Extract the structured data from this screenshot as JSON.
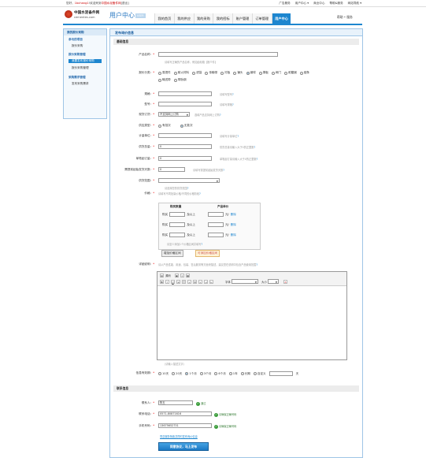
{
  "topbar": {
    "greeting_prefix": "您好，",
    "user": "1bchang1",
    "greeting_mid": "!欢迎来到",
    "site": "中国水泥备件网",
    "logout": "[退出]",
    "links": [
      "广告服务",
      "用户中心 ▾",
      "商业中心",
      "帮助&服务",
      "网站导航 ▾"
    ]
  },
  "header": {
    "logo_cn": "中国水泥备件网",
    "logo_en": "cementes.com",
    "ucenter": "用户中心",
    "ucenter_badge": "USER",
    "nav": [
      "我的首页",
      "我的供应",
      "我的采购",
      "我的招标",
      "账户管理",
      "订单管理",
      "用户中心"
    ],
    "nav_active": 6,
    "help": "帮助 • 服务"
  },
  "sidebar": {
    "title": "我的报价采购",
    "items": [
      {
        "label": "参与的项目",
        "kind": "sec"
      },
      {
        "label": "报价采购",
        "kind": "sub"
      },
      {
        "label": "报价采购管理",
        "kind": "sec"
      },
      {
        "label": "我要发布报价采购",
        "kind": "cur"
      },
      {
        "label": "报价采购管理",
        "kind": "sub"
      },
      {
        "label": "采购需求管理",
        "kind": "sec"
      },
      {
        "label": "发布采购需求",
        "kind": "sub"
      }
    ]
  },
  "main": {
    "title": "发布询价信息",
    "section1": "基础信息",
    "section2": "联系信息"
  },
  "form": {
    "product_name": {
      "label": "产品名称：",
      "hint": "请填写正确的产品名称，例如齿轮箱【推介件】"
    },
    "category": {
      "label": "报价分类：",
      "options": [
        "易损件",
        "耐火材料",
        "滤袋",
        "传输带",
        "衬板",
        "锤头",
        "钢球",
        "撑板",
        "阀门",
        "耐磨钢",
        "链条",
        "输送带",
        "带肋钢"
      ],
      "selected": 6
    },
    "spec": {
      "label": "规格：",
      "hint": "请填写型号"
    },
    "model": {
      "label": "型号：",
      "hint": "请填写规格"
    },
    "stock": {
      "label": "现货订货：",
      "value": "不支持网上订购",
      "hint": "选填产品支持网上订购"
    },
    "supply_type": {
      "label": "供应类型：",
      "options": [
        "有批次",
        "无批次"
      ],
      "selected": 1
    },
    "unit": {
      "label": "计量单位：",
      "hint": "请填写计量单位"
    },
    "min_order": {
      "label": "供货总量：",
      "value": "0",
      "hint": "供货总量请输入大于0的正整数"
    },
    "single_qty": {
      "label": "单笔起订量：",
      "value": "0",
      "hint": "单笔起订量请输入大于0的正整数"
    },
    "delivery_days": {
      "label": "需提前起始发货天数：",
      "value": "0",
      "hint": "请填写需提前起始发货天数"
    },
    "region": {
      "label": "供货范围：",
      "hint": "请选择您的供货范围"
    },
    "price": {
      "label": "价格：",
      "hint": "请填写不同批量价格/不同的价格阶段"
    },
    "tier": {
      "col1": "购买数量",
      "col2": "产品单价",
      "rows": [
        {
          "pre": "购买",
          "mid": "及以上",
          "unit": "元/",
          "del": "删除"
        },
        {
          "pre": "购买",
          "mid": "及以上",
          "unit": "元/",
          "del": "删除"
        },
        {
          "pre": "购买",
          "mid": "及以上",
          "unit": "元/",
          "del": "删除"
        }
      ],
      "note": "请至少添加1个价格区间并填写",
      "add": "增加价格区间",
      "copy": "可添加价格区间"
    },
    "detail": {
      "label": "详细说明：",
      "hint": "请从产品性能、用途、包装、售后服务等方面来描述，建议您在说明中包含产品使用范围",
      "editor_hint": "(请输入描述文字)"
    },
    "editor": {
      "font_label": "字体",
      "size_label": "大小",
      "source": "源码"
    },
    "validity": {
      "label": "信息有效期：",
      "options": [
        "10天",
        "20天",
        "1个月",
        "3个月",
        "6个月",
        "1年",
        "长期",
        "自定义"
      ],
      "selected": 2,
      "suffix": "天"
    },
    "contact_name": {
      "label": "联系人：",
      "value": "陈五",
      "status": "通过"
    },
    "contact_phone": {
      "label": "联系电话：",
      "value": "0571-80871616",
      "status": "请确保正确号码"
    },
    "mobile": {
      "label": "手机号码：",
      "value": "13675652731",
      "status": "请确保正确号码"
    },
    "agreement": "同意服务条款并同时发布询价信息",
    "submit": "同意协议，马上发布"
  }
}
